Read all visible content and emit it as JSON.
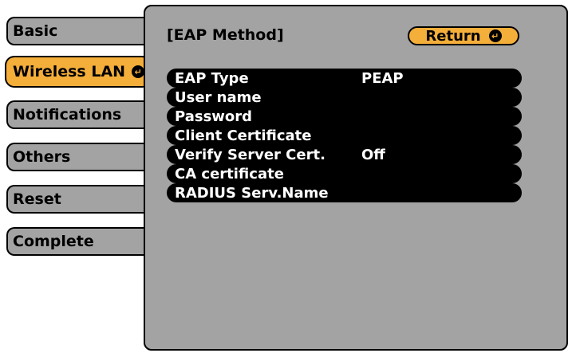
{
  "sidebar": {
    "items": [
      {
        "label": "Basic"
      },
      {
        "label": "Wireless LAN"
      },
      {
        "label": "Notifications"
      },
      {
        "label": "Others"
      },
      {
        "label": "Reset"
      },
      {
        "label": "Complete"
      }
    ]
  },
  "panel": {
    "title": "[EAP Method]",
    "return_label": "Return",
    "rows": [
      {
        "label": "EAP Type",
        "value": "PEAP"
      },
      {
        "label": "User name",
        "value": ""
      },
      {
        "label": "Password",
        "value": ""
      },
      {
        "label": "Client Certificate",
        "value": ""
      },
      {
        "label": "Verify Server Cert.",
        "value": "Off"
      },
      {
        "label": "CA certificate",
        "value": ""
      },
      {
        "label": "RADIUS Serv.Name",
        "value": ""
      }
    ]
  },
  "icons": {
    "enter": "enter-icon"
  },
  "colors": {
    "accent": "#f4ae3a",
    "panel": "#a3a3a3",
    "row": "#000000"
  }
}
